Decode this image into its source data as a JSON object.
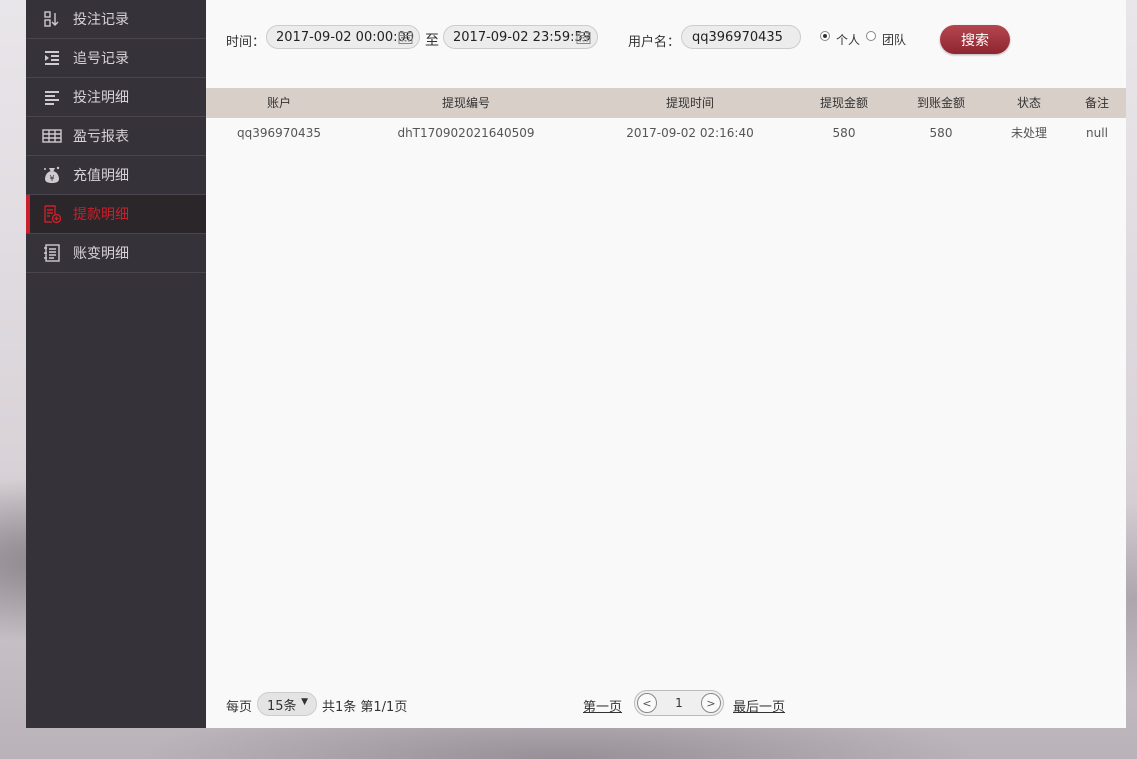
{
  "sidebar": {
    "items": [
      {
        "label": "投注记录",
        "icon": "list-sort-icon",
        "active": false
      },
      {
        "label": "追号记录",
        "icon": "indent-list-icon",
        "active": false
      },
      {
        "label": "投注明细",
        "icon": "text-lines-icon",
        "active": false
      },
      {
        "label": "盈亏报表",
        "icon": "table-icon",
        "active": false
      },
      {
        "label": "充值明细",
        "icon": "money-bag-icon",
        "active": false
      },
      {
        "label": "提款明细",
        "icon": "withdraw-document-icon",
        "active": true
      },
      {
        "label": "账变明细",
        "icon": "ledger-icon",
        "active": false
      }
    ]
  },
  "filters": {
    "time_label": "时间：",
    "start_time": "2017-09-02 00:00:00",
    "to_label": "至",
    "end_time": "2017-09-02 23:59:59",
    "username_label": "用户名：",
    "username": "qq396970435",
    "radio_personal": "个人",
    "radio_team": "团队",
    "search_button": "搜索"
  },
  "table": {
    "headers": [
      "账户",
      "提现编号",
      "提现时间",
      "提现金额",
      "到账金额",
      "状态",
      "备注"
    ],
    "rows": [
      [
        "qq396970435",
        "dhT170902021640509",
        "2017-09-02 02:16:40",
        "580",
        "580",
        "未处理",
        "null"
      ]
    ]
  },
  "footer": {
    "per_page_label": "每页",
    "per_page_value": "15条",
    "summary": "共1条 第1/1页",
    "first_page": "第一页",
    "current_page": "1",
    "last_page": "最后一页"
  },
  "colors": {
    "accent": "#c8202c",
    "sidebar_bg": "#363239",
    "table_header_bg": "#d8cfc8",
    "search_button": "#a23a44"
  }
}
